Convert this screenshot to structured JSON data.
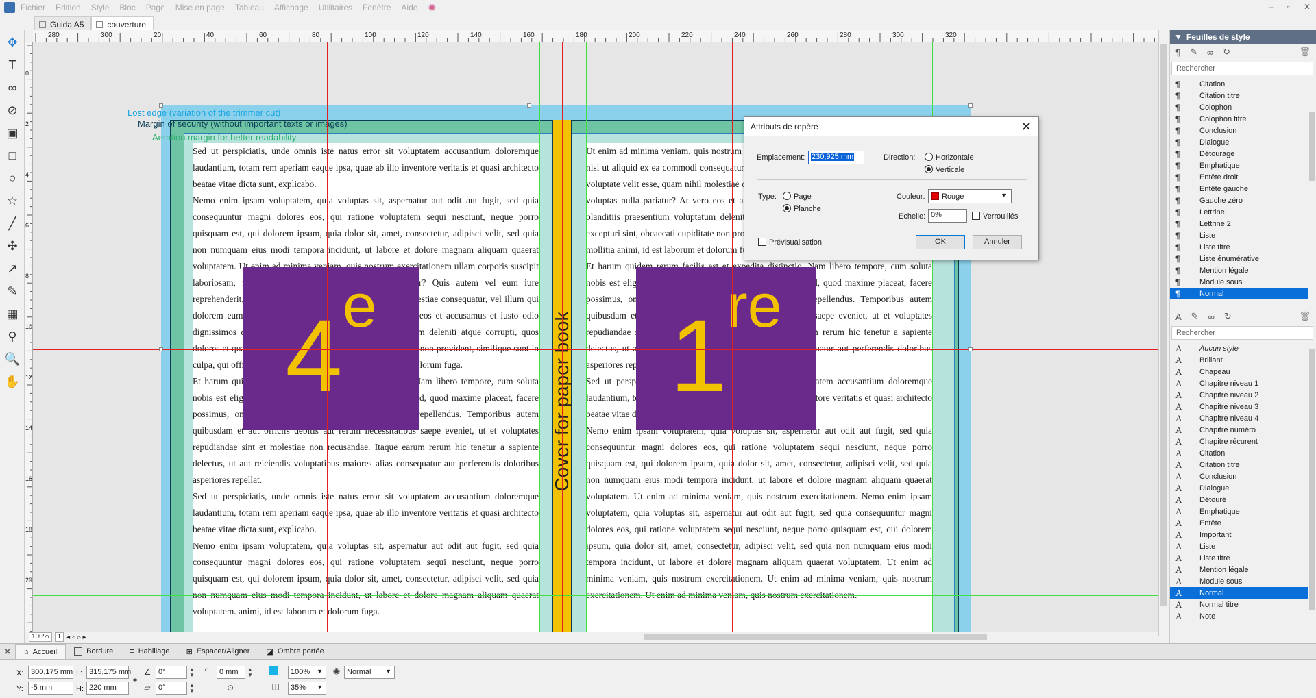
{
  "menubar": {
    "items": [
      "Fichier",
      "Edition",
      "Style",
      "Bloc",
      "Page",
      "Mise en page",
      "Tableau",
      "Affichage",
      "Utilitaires",
      "Fenêtre",
      "Aide"
    ],
    "window_controls": [
      "–",
      "▫",
      "✕"
    ]
  },
  "doc_tabs": [
    {
      "label": "Guida A5",
      "active": false
    },
    {
      "label": "couverture",
      "active": true
    }
  ],
  "toolbox": {
    "tools": [
      {
        "name": "move-tool-icon",
        "glyph": "✥"
      },
      {
        "name": "text-tool-icon",
        "glyph": "T"
      },
      {
        "name": "link-tool-icon",
        "glyph": "∞"
      },
      {
        "name": "unlink-tool-icon",
        "glyph": "⊘"
      },
      {
        "name": "image-tool-icon",
        "glyph": "▣"
      },
      {
        "name": "rectangle-tool-icon",
        "glyph": "□"
      },
      {
        "name": "ellipse-tool-icon",
        "glyph": "○"
      },
      {
        "name": "star-tool-icon",
        "glyph": "☆"
      },
      {
        "name": "line-tool-icon",
        "glyph": "╱"
      },
      {
        "name": "bezier-tool-icon",
        "glyph": "✣"
      },
      {
        "name": "polyline-tool-icon",
        "glyph": "↗"
      },
      {
        "name": "pen-tool-icon",
        "glyph": "✎"
      },
      {
        "name": "table-tool-icon",
        "glyph": "▦"
      },
      {
        "name": "eyedropper-tool-icon",
        "glyph": "⚲"
      },
      {
        "name": "zoom-tool-icon",
        "glyph": "🔍"
      },
      {
        "name": "hand-tool-icon",
        "glyph": "✋"
      }
    ]
  },
  "ruler": {
    "h_labels": [
      "280",
      "300",
      "20",
      "40",
      "60",
      "80",
      "100",
      "120",
      "140",
      "160",
      "180",
      "200",
      "220",
      "240",
      "260",
      "280",
      "300",
      "320"
    ],
    "v_labels": [
      "0",
      "2",
      "4",
      "6",
      "8",
      "100",
      "120",
      "140",
      "160",
      "180",
      "200"
    ]
  },
  "cover": {
    "lost_edge_label": "Lost edge (variation of the trimmer cut)",
    "security_label": "Margin of security (without important texts or images)",
    "aeration_label": "Aeration margin for better readability",
    "spine_label": "Cover for paper book",
    "back_cover": {
      "number": "4",
      "suffix": "e"
    },
    "front_cover": {
      "number": "1",
      "suffix": "re"
    },
    "left_text": "Sed ut perspiciatis, unde omnis iste natus error sit voluptatem accusantium doloremque laudantium, totam rem aperiam eaque ipsa, quae ab illo inventore veritatis et quasi architecto beatae vitae dicta sunt, explicabo.\nNemo enim ipsam voluptatem, quia voluptas sit, aspernatur aut odit aut fugit, sed quia consequuntur magni dolores eos, qui ratione voluptatem sequi nesciunt, neque porro quisquam est, qui dolorem ipsum, quia dolor sit, amet, consectetur, adipisci velit, sed quia non numquam eius modi tempora incidunt, ut labore et dolore magnam aliquam quaerat voluptatem. Ut enim ad minima veniam, quis nostrum exercitationem ullam corporis suscipit laboriosam, nisi ut aliquid ex ea commodi consequatur? Quis autem vel eum iure reprehenderit, qui in ea voluptate velit esse, quam nihil molestiae consequatur, vel illum qui dolorem eum fugiat, quo voluptas nulla pariatur? At vero eos et accusamus et iusto odio dignissimos ducimus, qui blanditiis praesentium voluptatum deleniti atque corrupti, quos dolores et quas molestias excepturi sint, obcaecati cupiditate non provident, similique sunt in culpa, qui officia deserunt mollitia animi, id est laborum et dolorum fuga.\nEt harum quidem rerum facilis est et expedita distinctio. Nam libero tempore, cum soluta nobis est eligendi optio, cumque nihil impedit, quo minus id, quod maxime placeat, facere possimus, omnis voluptas assumenda est, omnis dolor repellendus. Temporibus autem quibusdam et aut officiis debitis aut rerum necessitatibus saepe eveniet, ut et voluptates repudiandae sint et molestiae non recusandae. Itaque earum rerum hic tenetur a sapiente delectus, ut aut reiciendis voluptatibus maiores alias consequatur aut perferendis doloribus asperiores repellat.\nSed ut perspiciatis, unde omnis iste natus error sit voluptatem accusantium doloremque laudantium, totam rem aperiam eaque ipsa, quae ab illo inventore veritatis et quasi architecto beatae vitae dicta sunt, explicabo.\nNemo enim ipsam voluptatem, quia voluptas sit, aspernatur aut odit aut fugit, sed quia consequuntur magni dolores eos, qui ratione voluptatem sequi nesciunt, neque porro quisquam est, qui dolorem ipsum, quia dolor sit, amet, consectetur, adipisci velit, sed quia non numquam eius modi tempora incidunt, ut labore et dolore magnam aliquam quaerat voluptatem.  animi, id est laborum et dolorum fuga.",
    "right_text": "Ut enim ad minima veniam, quis nostrum exercitationem ullam corporis suscipit laboriosam, nisi ut aliquid ex ea commodi consequatur? Quis autem vel eum iure reprehenderit, qui in ea voluptate velit esse, quam nihil molestiae consequatur, vel illum qui dolorem eum fugiat, quo voluptas nulla pariatur? At vero eos et accusamus et iusto odio dignissimos ducimus, qui blanditiis praesentium voluptatum deleniti atque corrupti, quos dolores et quas molestias excepturi sint, obcaecati cupiditate non provident, similique sunt in culpa, qui officia deserunt mollitia animi, id est laborum et dolorum fuga.\nEt harum quidem rerum facilis est et expedita distinctio. Nam libero tempore, cum soluta nobis est eligendi optio, cumque nihil impedit, quo minus id, quod maxime placeat, facere possimus, omnis voluptas assumenda est, omnis dolor repellendus. Temporibus autem quibusdam et aut officiis debitis aut rerum necessitatibus saepe eveniet, ut et voluptates repudiandae sint et molestiae non recusandae. Itaque earum rerum hic tenetur a sapiente delectus, ut aut reiciendis voluptatibus maiores alias consequatur aut perferendis doloribus asperiores repellat.\nSed ut perspiciatis, unde omnis iste natus error sit voluptatem accusantium doloremque laudantium, totam rem aperiam eaque ipsa, quae ab illo inventore veritatis et quasi architecto beatae vitae dicta sunt, explicabo.\nNemo enim ipsam voluptatem, quia voluptas sit, aspernatur aut odit aut fugit, sed quia consequuntur magni dolores eos, qui ratione voluptatem sequi nesciunt, neque porro quisquam est, qui dolorem ipsum, quia dolor sit, amet, consectetur, adipisci velit, sed quia non numquam eius modi tempora incidunt, ut labore et dolore magnam aliquam quaerat voluptatem. Ut enim ad minima veniam, quis nostrum exercitationem. Nemo enim ipsam voluptatem, quia voluptas sit, aspernatur aut odit aut fugit, sed quia consequuntur magni dolores eos, qui ratione voluptatem sequi nesciunt, neque porro quisquam est, qui dolorem ipsum, quia dolor sit, amet, consectetur, adipisci velit, sed quia non numquam eius modi tempora incidunt, ut labore et dolore magnam aliquam quaerat voluptatem. Ut enim ad minima veniam, quis nostrum exercitationem. Ut enim ad minima veniam, quis nostrum exercitationem. Ut enim ad minima veniam, quis nostrum exercitationem."
  },
  "statusbar": {
    "zoom": "100%",
    "page": "1"
  },
  "dialog": {
    "title": "Attributs de repère",
    "location_label": "Emplacement:",
    "location_value": "230,925 mm",
    "direction_label": "Direction:",
    "horizontal_label": "Horizontale",
    "vertical_label": "Verticale",
    "type_label": "Type:",
    "page_label": "Page",
    "spread_label": "Planche",
    "color_label": "Couleur:",
    "color_value": "Rouge",
    "color_hex": "#e00000",
    "scale_label": "Echelle:",
    "scale_value": "0%",
    "locked_label": "Verrouillés",
    "preview_label": "Prévisualisation",
    "ok_label": "OK",
    "cancel_label": "Annuler"
  },
  "stylesheets_panel": {
    "title": "Feuilles de style",
    "search_placeholder": "Rechercher",
    "paragraph_styles": [
      "Citation",
      "Citation titre",
      "Colophon",
      "Colophon titre",
      "Conclusion",
      "Dialogue",
      "Détourage",
      "Emphatique",
      "Entête droit",
      "Entête gauche",
      "Gauche zéro",
      "Lettrine",
      "Lettrine 2",
      "Liste",
      "Liste titre",
      "Liste énumérative",
      "Mention légale",
      "Module sous",
      "Normal"
    ],
    "selected_paragraph_style": "Normal",
    "char_search_placeholder": "Rechercher",
    "character_styles": [
      "Aucun style",
      "Brillant",
      "Chapeau",
      "Chapitre niveau 1",
      "Chapitre niveau 2",
      "Chapitre niveau 3",
      "Chapitre niveau 4",
      "Chapitre numéro",
      "Chapitre récurent",
      "Citation",
      "Citation titre",
      "Conclusion",
      "Dialogue",
      "Détouré",
      "Emphatique",
      "Entête",
      "Important",
      "Liste",
      "Liste titre",
      "Mention légale",
      "Module sous",
      "Normal",
      "Normal titre",
      "Note"
    ],
    "selected_character_style": "Normal"
  },
  "bottom_tabs": [
    "Accueil",
    "Bordure",
    "Habillage",
    "Espacer/Aligner",
    "Ombre portée"
  ],
  "properties": {
    "x_label": "X:",
    "x_value": "300,175 mm",
    "y_label": "Y:",
    "y_value": "-5 mm",
    "l_label": "L:",
    "l_value": "315,175 mm",
    "h_label": "H:",
    "h_value": "220 mm",
    "rotation_value": "0°",
    "skew_value": "0°",
    "corner_value": "0 mm",
    "opacity_value": "100%",
    "shade_value": "35%",
    "blend_mode": "Normal"
  },
  "colors": {
    "bleed": "#8cd1ec",
    "cut_margin": "#6ec4a4",
    "spine": "#f2c200",
    "cover_box": "#6a2a8c",
    "cover_number": "#f2c200",
    "guide_red": "#e02020",
    "guide_green": "#40e040",
    "selection_blue": "#0a6fd8"
  }
}
